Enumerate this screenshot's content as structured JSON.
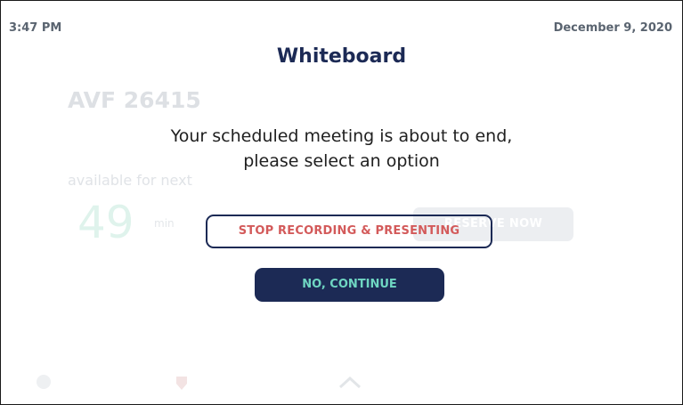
{
  "status": {
    "time": "3:47 PM",
    "date": "December 9, 2020"
  },
  "background": {
    "room_name": "AVF 26415",
    "availability_label": "available for next",
    "minutes": "49",
    "minutes_unit": "min",
    "reserve_label": "RESERVE NOW"
  },
  "dialog": {
    "title": "Whiteboard",
    "message_line1": "Your scheduled meeting is about to end,",
    "message_line2": "please select an option",
    "stop_label": "STOP RECORDING & PRESENTING",
    "continue_label": "NO, CONTINUE"
  },
  "icons": {
    "info": "info-icon",
    "badge": "badge-icon",
    "expand": "chevron-up-icon"
  },
  "colors": {
    "navy": "#1c2a55",
    "stop_text": "#d35a5a",
    "continue_text": "#6fd6c2"
  }
}
